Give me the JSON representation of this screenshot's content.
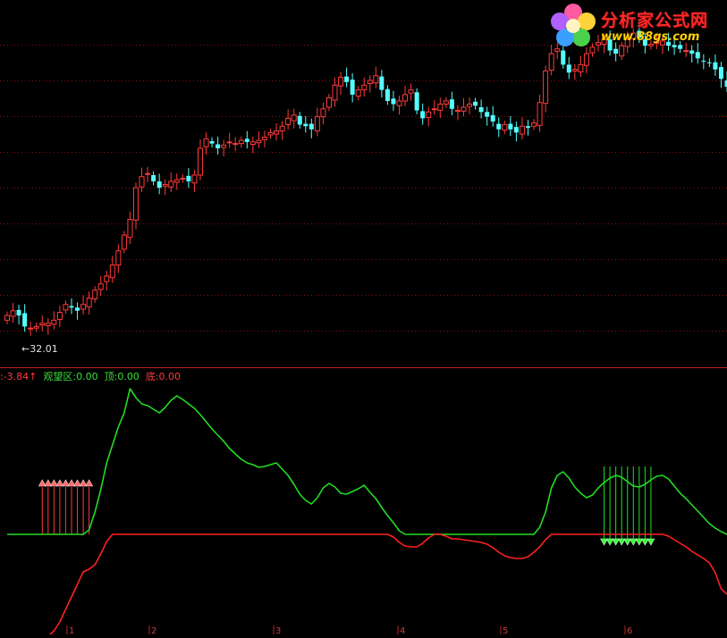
{
  "logo": {
    "text": "分析家公式网",
    "url_text": "www.88gs.com"
  },
  "price_panel": {
    "low_marker_label": "←32.01"
  },
  "indicator_header": {
    "lead_value": ":-3.84",
    "lead_arrow": "↑",
    "watch_label": "观望区:",
    "watch_value": "0.00",
    "top_label": "顶:",
    "top_value": "0.00",
    "bottom_label": "底:",
    "bottom_value": "0.00"
  },
  "colors": {
    "background": "#000000",
    "up_candle": "#ff3a3a",
    "down_candle": "#54ffff",
    "green_line": "#22dd22",
    "red_line": "#ff2020",
    "grid": "#8a1010",
    "watch_text": "#3ae03a"
  },
  "chart_data": [
    {
      "type": "candlestick",
      "title": "",
      "note": "approximate price path read from candle positions; no price axis is printed",
      "low_label_value": 32.01,
      "x": [
        1,
        2,
        3,
        4,
        5,
        6,
        7,
        8,
        9,
        10,
        11,
        12,
        13,
        14,
        15,
        16,
        17,
        18,
        19,
        20,
        21,
        22,
        23,
        24,
        25,
        26,
        27,
        28,
        29,
        30,
        31,
        32,
        33,
        34,
        35,
        36,
        37,
        38,
        39,
        40,
        41,
        42,
        43,
        44,
        45,
        46,
        47,
        48,
        49,
        50,
        51,
        52,
        53,
        54,
        55,
        56,
        57,
        58,
        59,
        60,
        61,
        62,
        63,
        64,
        65,
        66,
        67,
        68,
        69,
        70,
        71,
        72,
        73,
        74,
        75,
        76,
        77,
        78,
        79,
        80,
        81,
        82,
        83,
        84,
        85,
        86,
        87,
        88,
        89,
        90,
        91,
        92,
        93,
        94,
        95,
        96,
        97,
        98,
        99,
        100,
        101,
        102,
        103,
        104,
        105,
        106,
        107,
        108,
        109,
        110,
        111,
        112,
        113,
        114,
        115,
        116,
        117,
        118,
        119,
        120,
        121,
        122,
        123,
        124
      ],
      "close": [
        33.3,
        33.6,
        33.3,
        32.6,
        32.5,
        32.6,
        32.8,
        32.8,
        33.0,
        33.5,
        34.0,
        33.8,
        33.6,
        34.0,
        34.4,
        34.9,
        35.3,
        35.8,
        36.5,
        37.4,
        38.4,
        39.4,
        41.4,
        42.1,
        42.3,
        41.8,
        41.4,
        41.6,
        41.8,
        41.9,
        42.0,
        41.8,
        42.2,
        43.9,
        44.5,
        44.2,
        43.9,
        44.1,
        44.3,
        44.2,
        44.4,
        44.3,
        44.3,
        44.4,
        44.6,
        44.9,
        45.0,
        45.3,
        45.8,
        46.0,
        45.4,
        45.3,
        45.1,
        45.9,
        46.4,
        47.1,
        47.9,
        48.4,
        48.1,
        47.3,
        47.6,
        47.9,
        48.2,
        48.5,
        47.6,
        46.9,
        46.7,
        46.9,
        47.3,
        47.6,
        46.3,
        45.8,
        46.2,
        46.4,
        46.7,
        46.9,
        46.4,
        46.3,
        46.5,
        46.7,
        46.6,
        46.2,
        45.9,
        45.6,
        45.1,
        45.4,
        45.1,
        44.9,
        45.3,
        45.2,
        45.5,
        46.8,
        48.8,
        49.9,
        50.2,
        49.2,
        48.7,
        48.9,
        49.2,
        49.9,
        50.3,
        50.6,
        50.8,
        50.1,
        49.9,
        50.4,
        50.8,
        51.2,
        50.9,
        50.4,
        50.5,
        50.6,
        50.7,
        50.4,
        50.3,
        50.2,
        50.1,
        49.9,
        49.6,
        49.4,
        49.3,
        48.9,
        48.3,
        47.8
      ]
    },
    {
      "type": "line",
      "title": "",
      "x_tick_labels": [
        "1",
        "2",
        "3",
        "4",
        "5",
        "6"
      ],
      "series": [
        {
          "color": "green",
          "values": [
            0,
            0,
            0,
            0,
            0,
            0,
            0,
            0,
            0,
            0,
            0,
            0,
            0,
            0,
            0.5,
            2.5,
            5,
            8,
            10,
            12,
            13.6,
            16.3,
            15.3,
            14.6,
            14.4,
            14.0,
            13.6,
            14.2,
            15.0,
            15.5,
            15.1,
            14.6,
            14.1,
            13.4,
            12.6,
            11.8,
            11.1,
            10.4,
            9.6,
            9.0,
            8.4,
            8.0,
            7.8,
            7.5,
            7.6,
            7.8,
            8.0,
            7.3,
            6.6,
            5.6,
            4.5,
            3.8,
            3.4,
            4.1,
            5.2,
            5.7,
            5.3,
            4.6,
            4.5,
            4.8,
            5.1,
            5.5,
            4.7,
            4.0,
            3.0,
            2.1,
            1.3,
            0.4,
            0,
            0,
            0,
            0,
            0,
            0,
            0,
            0,
            0,
            0,
            0,
            0,
            0,
            0,
            0,
            0,
            0,
            0,
            0,
            0,
            0,
            0,
            0,
            0.8,
            2.5,
            5.2,
            6.6,
            7.0,
            6.3,
            5.3,
            4.6,
            4.1,
            4.4,
            5.2,
            5.8,
            6.3,
            6.6,
            6.4,
            5.9,
            5.4,
            5.3,
            5.6,
            6.1,
            6.5,
            6.6,
            6.2,
            5.4,
            4.6,
            4.0,
            3.3,
            2.6,
            1.9,
            1.2,
            0.7,
            0.3,
            0,
            0,
            0
          ]
        },
        {
          "color": "red",
          "values": [
            -11.6,
            -11.6,
            -11.8,
            -11.7,
            -11.9,
            -11.8,
            -11.8,
            -11.4,
            -10.8,
            -9.8,
            -8.4,
            -7.0,
            -5.6,
            -4.2,
            -3.9,
            -3.4,
            -2.2,
            -0.8,
            0,
            0,
            0,
            0,
            0,
            0,
            0,
            0,
            0,
            0,
            0,
            0,
            0,
            0,
            0,
            0,
            0,
            0,
            0,
            0,
            0,
            0,
            0,
            0,
            0,
            0,
            0,
            0,
            0,
            0,
            0,
            0,
            0,
            0,
            0,
            0,
            0,
            0,
            0,
            0,
            0,
            0,
            0,
            0,
            0,
            0,
            0,
            0,
            -0.3,
            -0.9,
            -1.3,
            -1.4,
            -1.4,
            -1.0,
            -0.4,
            0,
            0,
            -0.2,
            -0.5,
            -0.5,
            -0.6,
            -0.7,
            -0.8,
            -0.9,
            -1.1,
            -1.5,
            -2.0,
            -2.4,
            -2.6,
            -2.7,
            -2.7,
            -2.5,
            -2.0,
            -1.4,
            -0.6,
            0,
            0,
            0,
            0,
            0,
            0,
            0,
            0,
            0,
            0,
            0,
            0,
            0,
            0,
            0,
            0,
            0,
            0,
            0,
            0,
            -0.2,
            -0.6,
            -1.0,
            -1.4,
            -1.9,
            -2.3,
            -2.7,
            -3.2,
            -4.3,
            -6.1,
            -6.7
          ]
        }
      ],
      "buy_arrow_bars": [
        7,
        8,
        9,
        10,
        11,
        12,
        13,
        14,
        15
      ],
      "sell_arrow_bars": [
        103,
        104,
        105,
        106,
        107,
        108,
        109,
        110,
        111
      ]
    }
  ]
}
